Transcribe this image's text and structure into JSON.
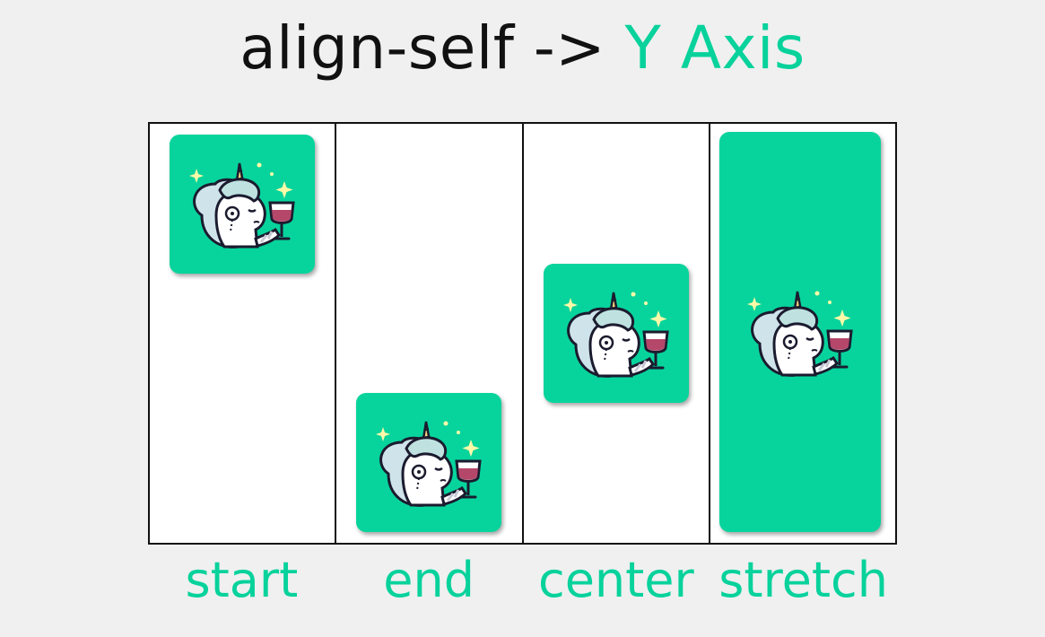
{
  "title": {
    "main": "align-self ->",
    "accent": "Y Axis"
  },
  "columns": [
    {
      "label": "start"
    },
    {
      "label": "end"
    },
    {
      "label": "center"
    },
    {
      "label": "stretch"
    }
  ],
  "colors": {
    "accent": "#08d29c",
    "tile": "#07d49c",
    "border": "#111111",
    "background": "#f0f0f0"
  },
  "icon": "unicorn-wine-icon"
}
